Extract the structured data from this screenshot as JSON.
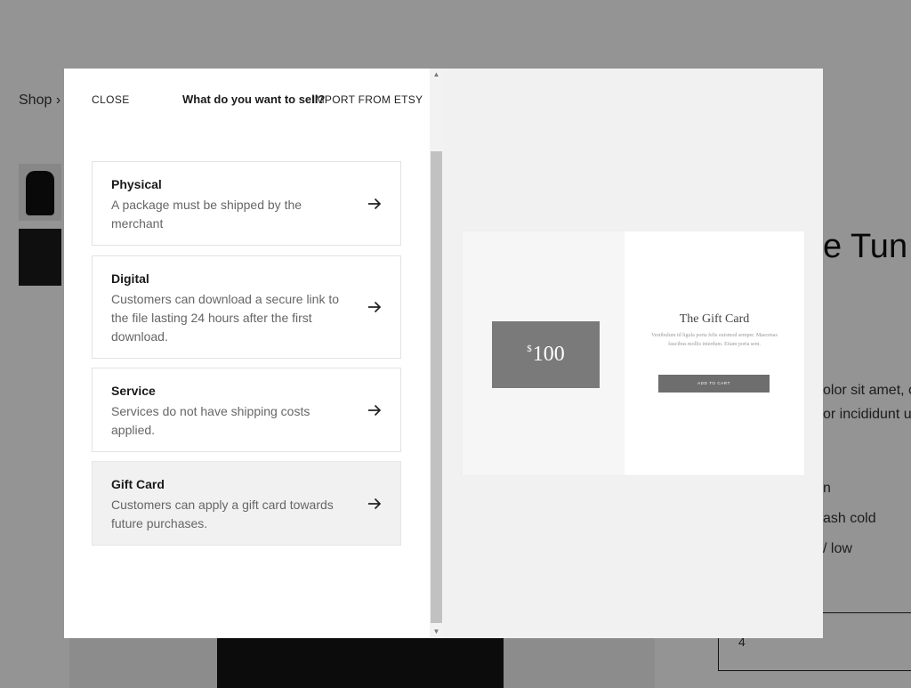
{
  "background": {
    "breadcrumb": "Shop ›",
    "product_title_partial": "e Tun",
    "description_lines": [
      "olor sit amet, c",
      "or incididunt u"
    ],
    "care_lines": [
      "n",
      "ash cold",
      "/ low"
    ],
    "quantity_value": "4"
  },
  "modal": {
    "close_label": "CLOSE",
    "title": "What do you want to sell?",
    "import_label": "IMPORT FROM ETSY",
    "options": [
      {
        "title": "Physical",
        "description": "A package must be shipped by the merchant"
      },
      {
        "title": "Digital",
        "description": "Customers can download a secure link to the file lasting 24 hours after the first download."
      },
      {
        "title": "Service",
        "description": "Services do not have shipping costs applied."
      },
      {
        "title": "Gift Card",
        "description": "Customers can apply a gift card towards future purchases."
      }
    ],
    "selected_option": "Gift Card",
    "scrollbar": {
      "up_glyph": "▲",
      "down_glyph": "▼"
    }
  },
  "preview": {
    "currency_symbol": "$",
    "amount": "100",
    "title": "The Gift Card",
    "description": "Vestibulum id ligula porta felis euismod semper. Maecenas faucibus mollis interdum. Etiam porta sem.",
    "button_label": "ADD TO CART"
  },
  "colors": {
    "overlay": "#6b6b6b",
    "selected_option_bg": "#f1f1f1",
    "preview_pane_bg": "#f1f1f1",
    "gift_card_bg": "#7a7a7a",
    "scrollbar_thumb": "#c1c1c1"
  },
  "icons": {
    "option_arrow": "arrow-right-icon"
  }
}
